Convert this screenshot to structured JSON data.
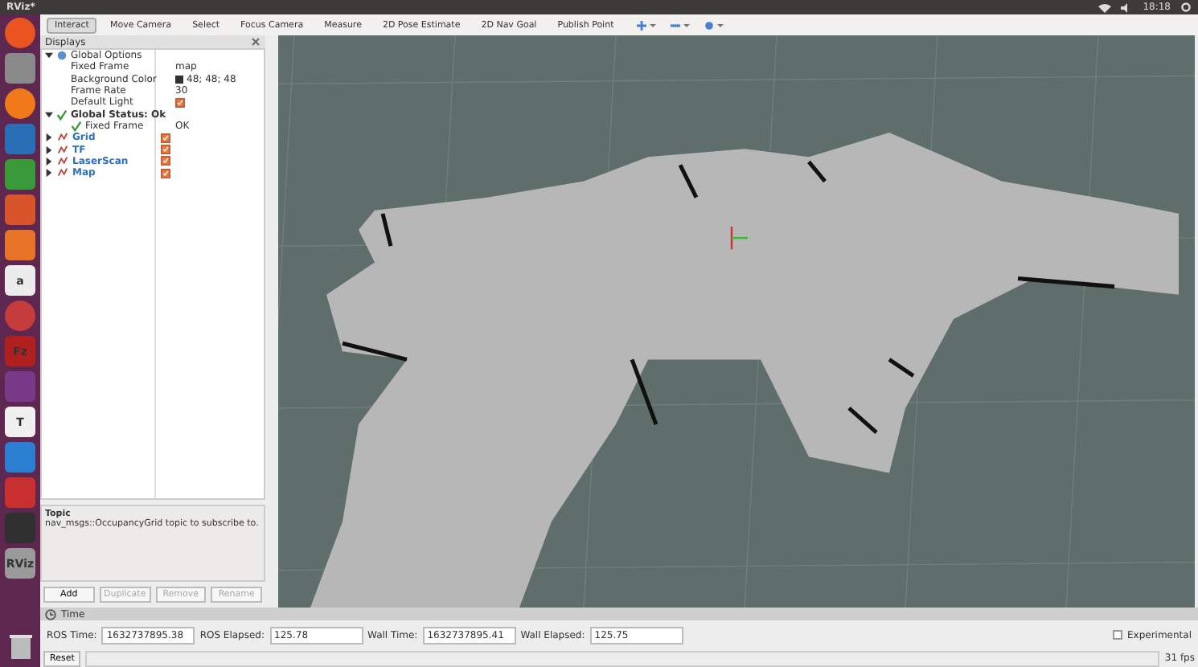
{
  "topbar": {
    "title": "RViz*",
    "clock": "18:18"
  },
  "launcher": [
    {
      "kind": "round",
      "color": "#e95420"
    },
    {
      "kind": "box",
      "color": "#8a8a8a"
    },
    {
      "kind": "round",
      "color": "#f07a1a"
    },
    {
      "kind": "box",
      "color": "#2a6fb5"
    },
    {
      "kind": "box",
      "color": "#3a9a3a"
    },
    {
      "kind": "box",
      "color": "#d8552c"
    },
    {
      "kind": "box",
      "color": "#e8742a"
    },
    {
      "kind": "box",
      "color": "#ececec",
      "glyph": "a"
    },
    {
      "kind": "round",
      "color": "#c43c3c"
    },
    {
      "kind": "box",
      "color": "#b02020",
      "glyph": "Fz"
    },
    {
      "kind": "box",
      "color": "#7a3a8a"
    },
    {
      "kind": "box",
      "color": "#f0f0f0",
      "glyph": "T"
    },
    {
      "kind": "box",
      "color": "#2a7fd0"
    },
    {
      "kind": "box",
      "color": "#c83030"
    },
    {
      "kind": "box",
      "color": "#303030"
    },
    {
      "kind": "box",
      "color": "#9a9a9a",
      "glyph": "RViz"
    }
  ],
  "toolbar": [
    {
      "label": "Interact",
      "selected": true
    },
    {
      "label": "Move Camera",
      "selected": false
    },
    {
      "label": "Select",
      "selected": false
    },
    {
      "label": "Focus Camera",
      "selected": false
    },
    {
      "label": "Measure",
      "selected": false
    },
    {
      "label": "2D Pose Estimate",
      "selected": false
    },
    {
      "label": "2D Nav Goal",
      "selected": false
    },
    {
      "label": "Publish Point",
      "selected": false
    }
  ],
  "displays": {
    "title": "Displays",
    "tree": [
      {
        "kind": "options",
        "label": "Global Options",
        "expanded": true,
        "children": [
          {
            "kind": "property",
            "label": "Fixed Frame",
            "value": "map"
          },
          {
            "kind": "color",
            "label": "Background Color",
            "value": "48; 48; 48",
            "color": "#303030"
          },
          {
            "kind": "property",
            "label": "Frame Rate",
            "value": "30"
          },
          {
            "kind": "check",
            "label": "Default Light",
            "checked": true
          }
        ]
      },
      {
        "kind": "status",
        "label": "Global Status: Ok",
        "expanded": true,
        "children": [
          {
            "kind": "status",
            "label": "Fixed Frame",
            "value": "OK"
          }
        ]
      },
      {
        "kind": "display",
        "label": "Grid",
        "expanded": false,
        "checked": true
      },
      {
        "kind": "display",
        "label": "TF",
        "expanded": false,
        "checked": true
      },
      {
        "kind": "display",
        "label": "LaserScan",
        "expanded": false,
        "checked": true
      },
      {
        "kind": "display",
        "label": "Map",
        "expanded": false,
        "checked": true
      }
    ]
  },
  "help": {
    "title": "Topic",
    "text": "nav_msgs::OccupancyGrid topic to subscribe to."
  },
  "buttons": [
    {
      "label": "Add",
      "disabled": false
    },
    {
      "label": "Duplicate",
      "disabled": true
    },
    {
      "label": "Remove",
      "disabled": true
    },
    {
      "label": "Rename",
      "disabled": true
    }
  ],
  "time": {
    "title": "Time",
    "fields": [
      {
        "label": "ROS Time:",
        "value": "1632737895.38"
      },
      {
        "label": "ROS Elapsed:",
        "value": "125.78"
      },
      {
        "label": "Wall Time:",
        "value": "1632737895.41"
      },
      {
        "label": "Wall Elapsed:",
        "value": "125.75"
      }
    ],
    "experimental": {
      "label": "Experimental",
      "checked": false
    },
    "reset": "Reset",
    "fps": "31 fps"
  }
}
